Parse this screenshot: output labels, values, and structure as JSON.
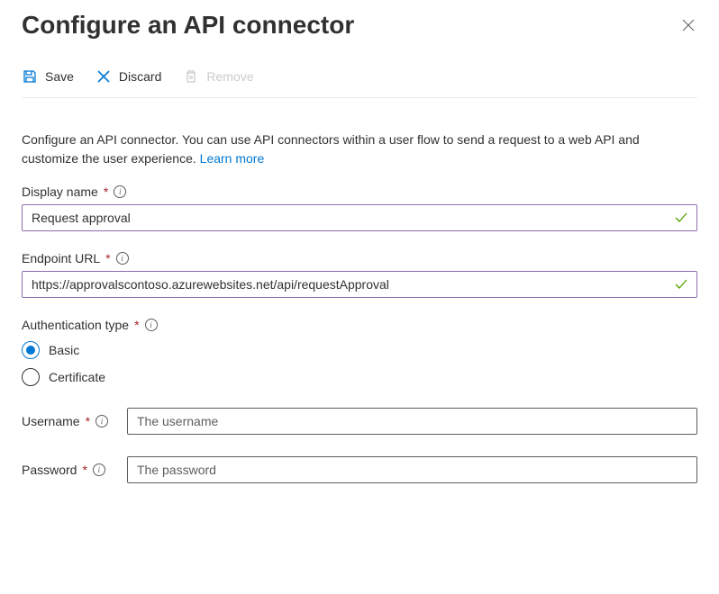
{
  "header": {
    "title": "Configure an API connector"
  },
  "toolbar": {
    "save_label": "Save",
    "discard_label": "Discard",
    "remove_label": "Remove"
  },
  "description": {
    "text": "Configure an API connector. You can use API connectors within a user flow to send a request to a web API and customize the user experience. ",
    "learn_more": "Learn more"
  },
  "fields": {
    "display_name": {
      "label": "Display name",
      "value": "Request approval"
    },
    "endpoint_url": {
      "label": "Endpoint URL",
      "value": "https://approvalscontoso.azurewebsites.net/api/requestApproval"
    },
    "auth_type": {
      "label": "Authentication type",
      "options": {
        "basic": "Basic",
        "certificate": "Certificate"
      },
      "selected": "basic"
    },
    "username": {
      "label": "Username",
      "placeholder": "The username"
    },
    "password": {
      "label": "Password",
      "placeholder": "The password"
    }
  }
}
